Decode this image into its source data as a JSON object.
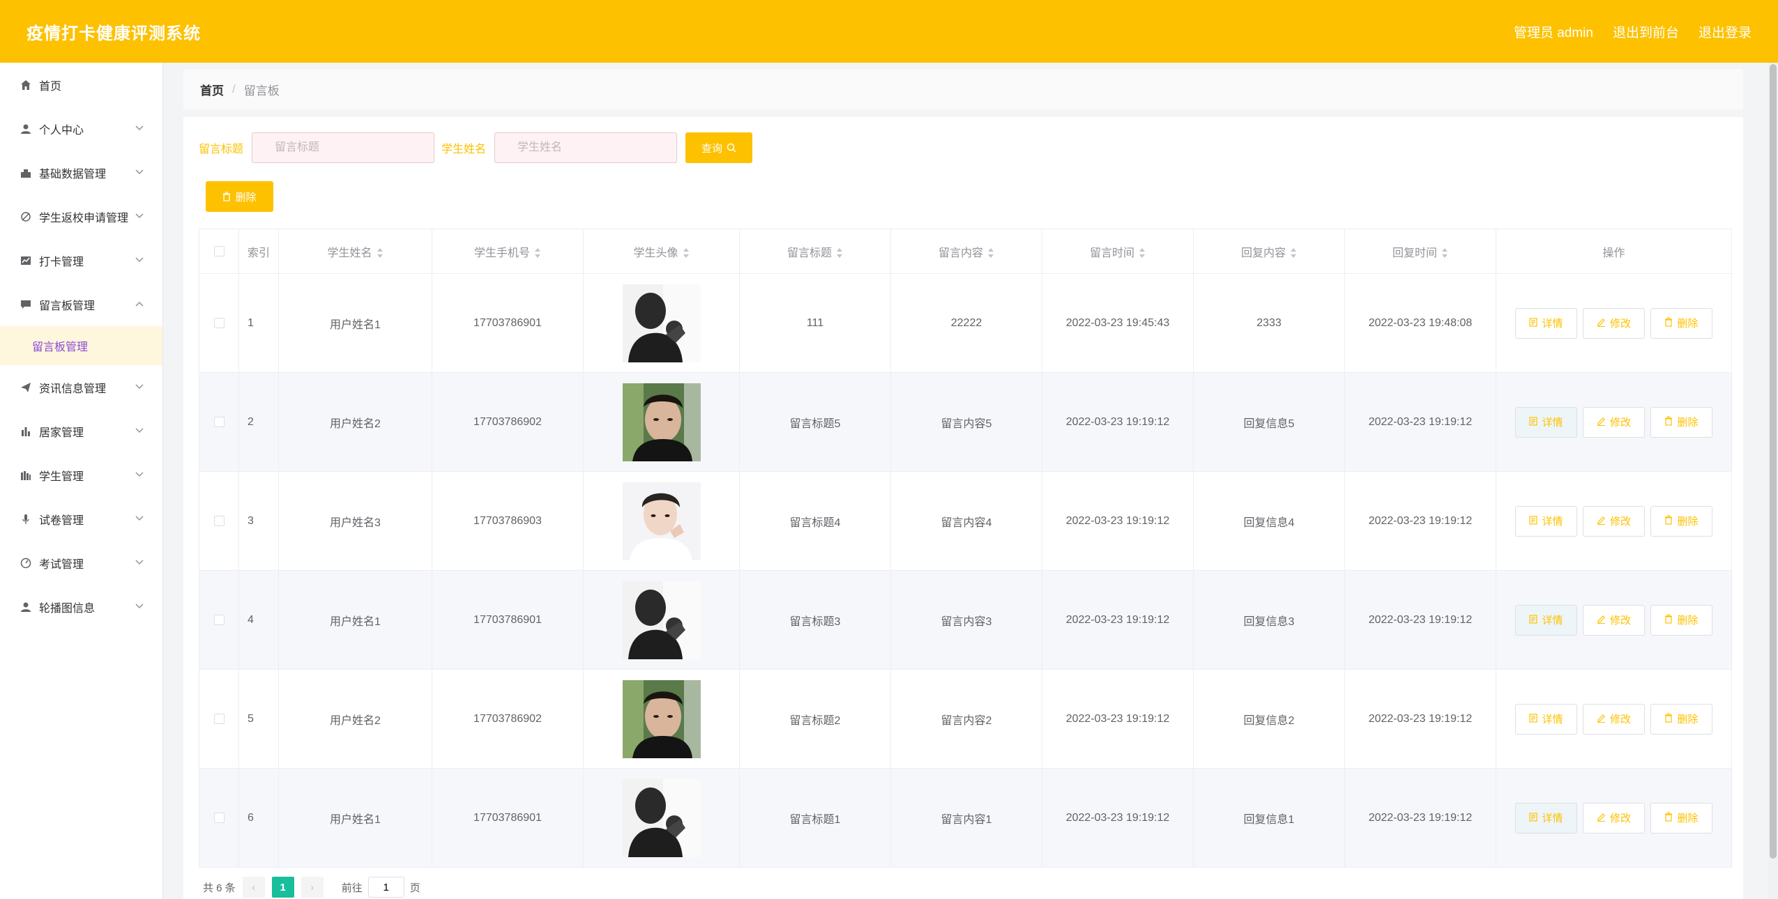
{
  "app": {
    "title": "疫情打卡健康评测系统",
    "admin_label": "管理员 admin",
    "to_frontend": "退出到前台",
    "logout": "退出登录"
  },
  "colors": {
    "accent": "#fdc100",
    "active_submenu_bg": "#fff6de",
    "active_submenu_text": "#8a4bd7",
    "page_active": "#19be9c"
  },
  "sidebar": {
    "items": [
      {
        "label": "首页",
        "icon": "home-icon"
      },
      {
        "label": "个人中心",
        "icon": "user-icon"
      },
      {
        "label": "基础数据管理",
        "icon": "data-icon"
      },
      {
        "label": "学生返校申请管理",
        "icon": "compass-icon"
      },
      {
        "label": "打卡管理",
        "icon": "chart-icon"
      },
      {
        "label": "留言板管理",
        "icon": "message-icon"
      },
      {
        "label": "资讯信息管理",
        "icon": "send-icon"
      },
      {
        "label": "居家管理",
        "icon": "bar-chart-icon"
      },
      {
        "label": "学生管理",
        "icon": "columns-icon"
      },
      {
        "label": "试卷管理",
        "icon": "mic-icon"
      },
      {
        "label": "考试管理",
        "icon": "gauge-icon"
      },
      {
        "label": "轮播图信息",
        "icon": "person-icon"
      }
    ],
    "active_sub": "留言板管理"
  },
  "breadcrumb": {
    "home": "首页",
    "sep": "/",
    "current": "留言板"
  },
  "filter": {
    "title_label": "留言标题",
    "title_placeholder": "留言标题",
    "name_label": "学生姓名",
    "name_placeholder": "学生姓名",
    "query": "查询",
    "delete": "删除"
  },
  "table": {
    "headers": [
      "索引",
      "学生姓名",
      "学生手机号",
      "学生头像",
      "留言标题",
      "留言内容",
      "留言时间",
      "回复内容",
      "回复时间",
      "操作"
    ],
    "actions": {
      "detail": "详情",
      "edit": "修改",
      "delete": "删除"
    },
    "rows": [
      {
        "index": "1",
        "name": "用户姓名1",
        "phone": "17703786901",
        "avatar": "avatar-1",
        "title": "111",
        "content": "22222",
        "time": "2022-03-23 19:45:43",
        "reply": "2333",
        "reply_time": "2022-03-23 19:48:08"
      },
      {
        "index": "2",
        "name": "用户姓名2",
        "phone": "17703786902",
        "avatar": "avatar-2",
        "title": "留言标题5",
        "content": "留言内容5",
        "time": "2022-03-23 19:19:12",
        "reply": "回复信息5",
        "reply_time": "2022-03-23 19:19:12"
      },
      {
        "index": "3",
        "name": "用户姓名3",
        "phone": "17703786903",
        "avatar": "avatar-3",
        "title": "留言标题4",
        "content": "留言内容4",
        "time": "2022-03-23 19:19:12",
        "reply": "回复信息4",
        "reply_time": "2022-03-23 19:19:12"
      },
      {
        "index": "4",
        "name": "用户姓名1",
        "phone": "17703786901",
        "avatar": "avatar-1",
        "title": "留言标题3",
        "content": "留言内容3",
        "time": "2022-03-23 19:19:12",
        "reply": "回复信息3",
        "reply_time": "2022-03-23 19:19:12"
      },
      {
        "index": "5",
        "name": "用户姓名2",
        "phone": "17703786902",
        "avatar": "avatar-2",
        "title": "留言标题2",
        "content": "留言内容2",
        "time": "2022-03-23 19:19:12",
        "reply": "回复信息2",
        "reply_time": "2022-03-23 19:19:12"
      },
      {
        "index": "6",
        "name": "用户姓名1",
        "phone": "17703786901",
        "avatar": "avatar-1",
        "title": "留言标题1",
        "content": "留言内容1",
        "time": "2022-03-23 19:19:12",
        "reply": "回复信息1",
        "reply_time": "2022-03-23 19:19:12"
      }
    ]
  },
  "pagination": {
    "total": "共 6 条",
    "current_page": "1",
    "goto_label": "前往",
    "goto_value": "1",
    "page_suffix": "页",
    "prev": "‹",
    "next": "›"
  }
}
